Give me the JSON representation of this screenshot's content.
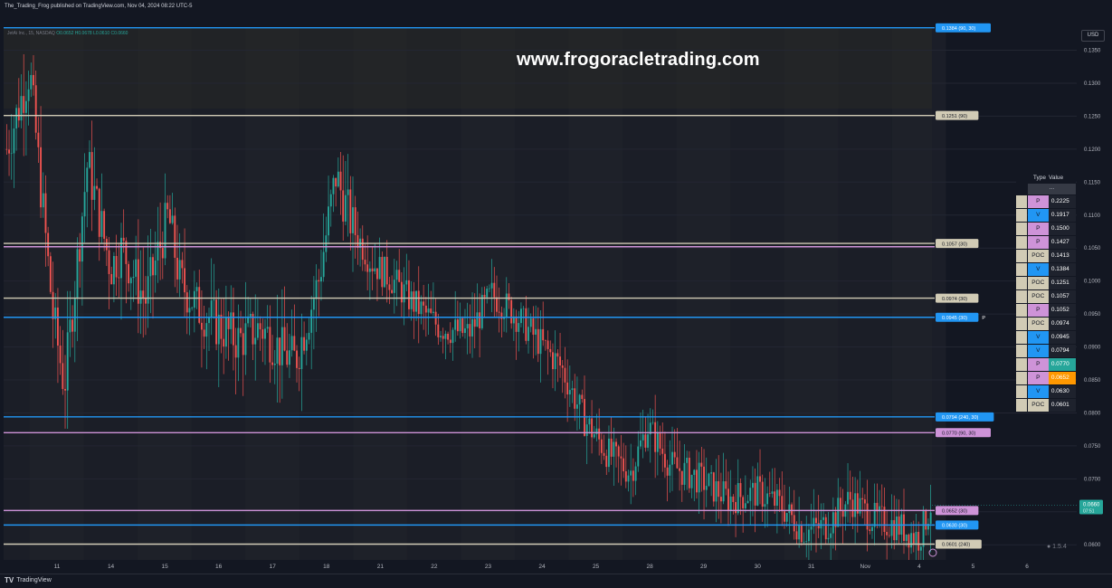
{
  "header": {
    "published": "The_Trading_Frog published on TradingView.com, Nov 04, 2024 08:22 UTC-5"
  },
  "legend": {
    "symbol": "JetAi Inc., 15, NASDAQ",
    "o": "O0.0652",
    "h": "H0.0678",
    "l": "L0.0610",
    "c": "C0.0660"
  },
  "watermark": "www.frogoracletrading.com",
  "currency": "USD",
  "footer": {
    "brand": "TradingView",
    "logo": "TV"
  },
  "colors": {
    "bg": "#131722",
    "up": "#26a69a",
    "down": "#ef5350",
    "poc": "#d1cbb5",
    "p": "#ce93d8",
    "v": "#2196f3"
  },
  "level_table": {
    "headers": [
      "Type",
      "Value"
    ],
    "sub": "...",
    "rows": [
      {
        "type": "P",
        "value": "0.2225"
      },
      {
        "type": "V",
        "value": "0.1917"
      },
      {
        "type": "P",
        "value": "0.1500"
      },
      {
        "type": "P",
        "value": "0.1427"
      },
      {
        "type": "POC",
        "value": "0.1413"
      },
      {
        "type": "V",
        "value": "0.1384"
      },
      {
        "type": "POC",
        "value": "0.1251"
      },
      {
        "type": "POC",
        "value": "0.1057"
      },
      {
        "type": "P",
        "value": "0.1052"
      },
      {
        "type": "POC",
        "value": "0.0974"
      },
      {
        "type": "V",
        "value": "0.0945"
      },
      {
        "type": "V",
        "value": "0.0794"
      },
      {
        "type": "P",
        "value": "0.0770"
      },
      {
        "type": "P",
        "value": "0.0652"
      },
      {
        "type": "V",
        "value": "0.0630"
      },
      {
        "type": "POC",
        "value": "0.0601"
      }
    ]
  },
  "chart_data": {
    "type": "candlestick",
    "title": "JetAi Inc., 15, NASDAQ",
    "x_ticks": [
      "11",
      "14",
      "15",
      "16",
      "17",
      "18",
      "21",
      "22",
      "23",
      "24",
      "25",
      "28",
      "29",
      "30",
      "31",
      "Nov",
      "4",
      "5",
      "6"
    ],
    "y_ticks": [
      0.135,
      0.13,
      0.125,
      0.12,
      0.115,
      0.11,
      0.105,
      0.1,
      0.095,
      0.09,
      0.085,
      0.08,
      0.075,
      0.07,
      0.065,
      0.06
    ],
    "ylim": [
      0.0577,
      0.1385
    ],
    "price_series": [
      [
        0,
        0.12
      ],
      [
        0.4,
        0.132
      ],
      [
        0.8,
        0.095
      ],
      [
        1.0,
        0.084
      ],
      [
        1.4,
        0.118
      ],
      [
        1.8,
        0.102
      ],
      [
        2.0,
        0.105
      ],
      [
        2.4,
        0.097
      ],
      [
        2.8,
        0.11
      ],
      [
        3.0,
        0.1
      ],
      [
        3.3,
        0.096
      ],
      [
        3.7,
        0.093
      ],
      [
        4.0,
        0.091
      ],
      [
        4.4,
        0.093
      ],
      [
        4.8,
        0.089
      ],
      [
        5.0,
        0.088
      ],
      [
        5.4,
        0.1
      ],
      [
        5.7,
        0.116
      ],
      [
        6.0,
        0.108
      ],
      [
        6.3,
        0.103
      ],
      [
        6.7,
        0.1
      ],
      [
        7.0,
        0.097
      ],
      [
        7.5,
        0.093
      ],
      [
        8.0,
        0.092
      ],
      [
        8.4,
        0.098
      ],
      [
        8.8,
        0.095
      ],
      [
        9.2,
        0.091
      ],
      [
        9.6,
        0.087
      ],
      [
        10.0,
        0.079
      ],
      [
        10.4,
        0.074
      ],
      [
        10.8,
        0.071
      ],
      [
        11.1,
        0.078
      ],
      [
        11.5,
        0.072
      ],
      [
        12.0,
        0.07
      ],
      [
        12.5,
        0.067
      ],
      [
        13.0,
        0.068
      ],
      [
        13.4,
        0.066
      ],
      [
        13.8,
        0.062
      ],
      [
        14.2,
        0.063
      ],
      [
        14.6,
        0.067
      ],
      [
        15.0,
        0.064
      ],
      [
        15.4,
        0.063
      ],
      [
        15.8,
        0.061
      ],
      [
        16.0,
        0.066
      ]
    ],
    "levels": [
      {
        "value": 0.1384,
        "label": "0.1384 (90, 30)",
        "kind": "V"
      },
      {
        "value": 0.1251,
        "label": "0.1251 (90)",
        "kind": "POC"
      },
      {
        "value": 0.1057,
        "label": "0.1057 (30)",
        "kind": "POC"
      },
      {
        "value": 0.1052,
        "label": "",
        "kind": "P"
      },
      {
        "value": 0.0974,
        "label": "0.0974 (30)",
        "kind": "POC"
      },
      {
        "value": 0.0945,
        "label": "0.0945 (30)",
        "tag": "P",
        "kind": "V"
      },
      {
        "value": 0.0794,
        "label": "0.0794 (240, 30)",
        "kind": "V"
      },
      {
        "value": 0.077,
        "label": "0.0770 (90, 30)",
        "kind": "P"
      },
      {
        "value": 0.0652,
        "label": "0.0652 (30)",
        "kind": "P"
      },
      {
        "value": 0.063,
        "label": "0.0630 (30)",
        "kind": "V"
      },
      {
        "value": 0.0601,
        "label": "0.0601 (240)",
        "kind": "POC"
      }
    ],
    "last_price": {
      "value": 0.066,
      "label": "0.0660",
      "countdown": "07:51"
    }
  }
}
